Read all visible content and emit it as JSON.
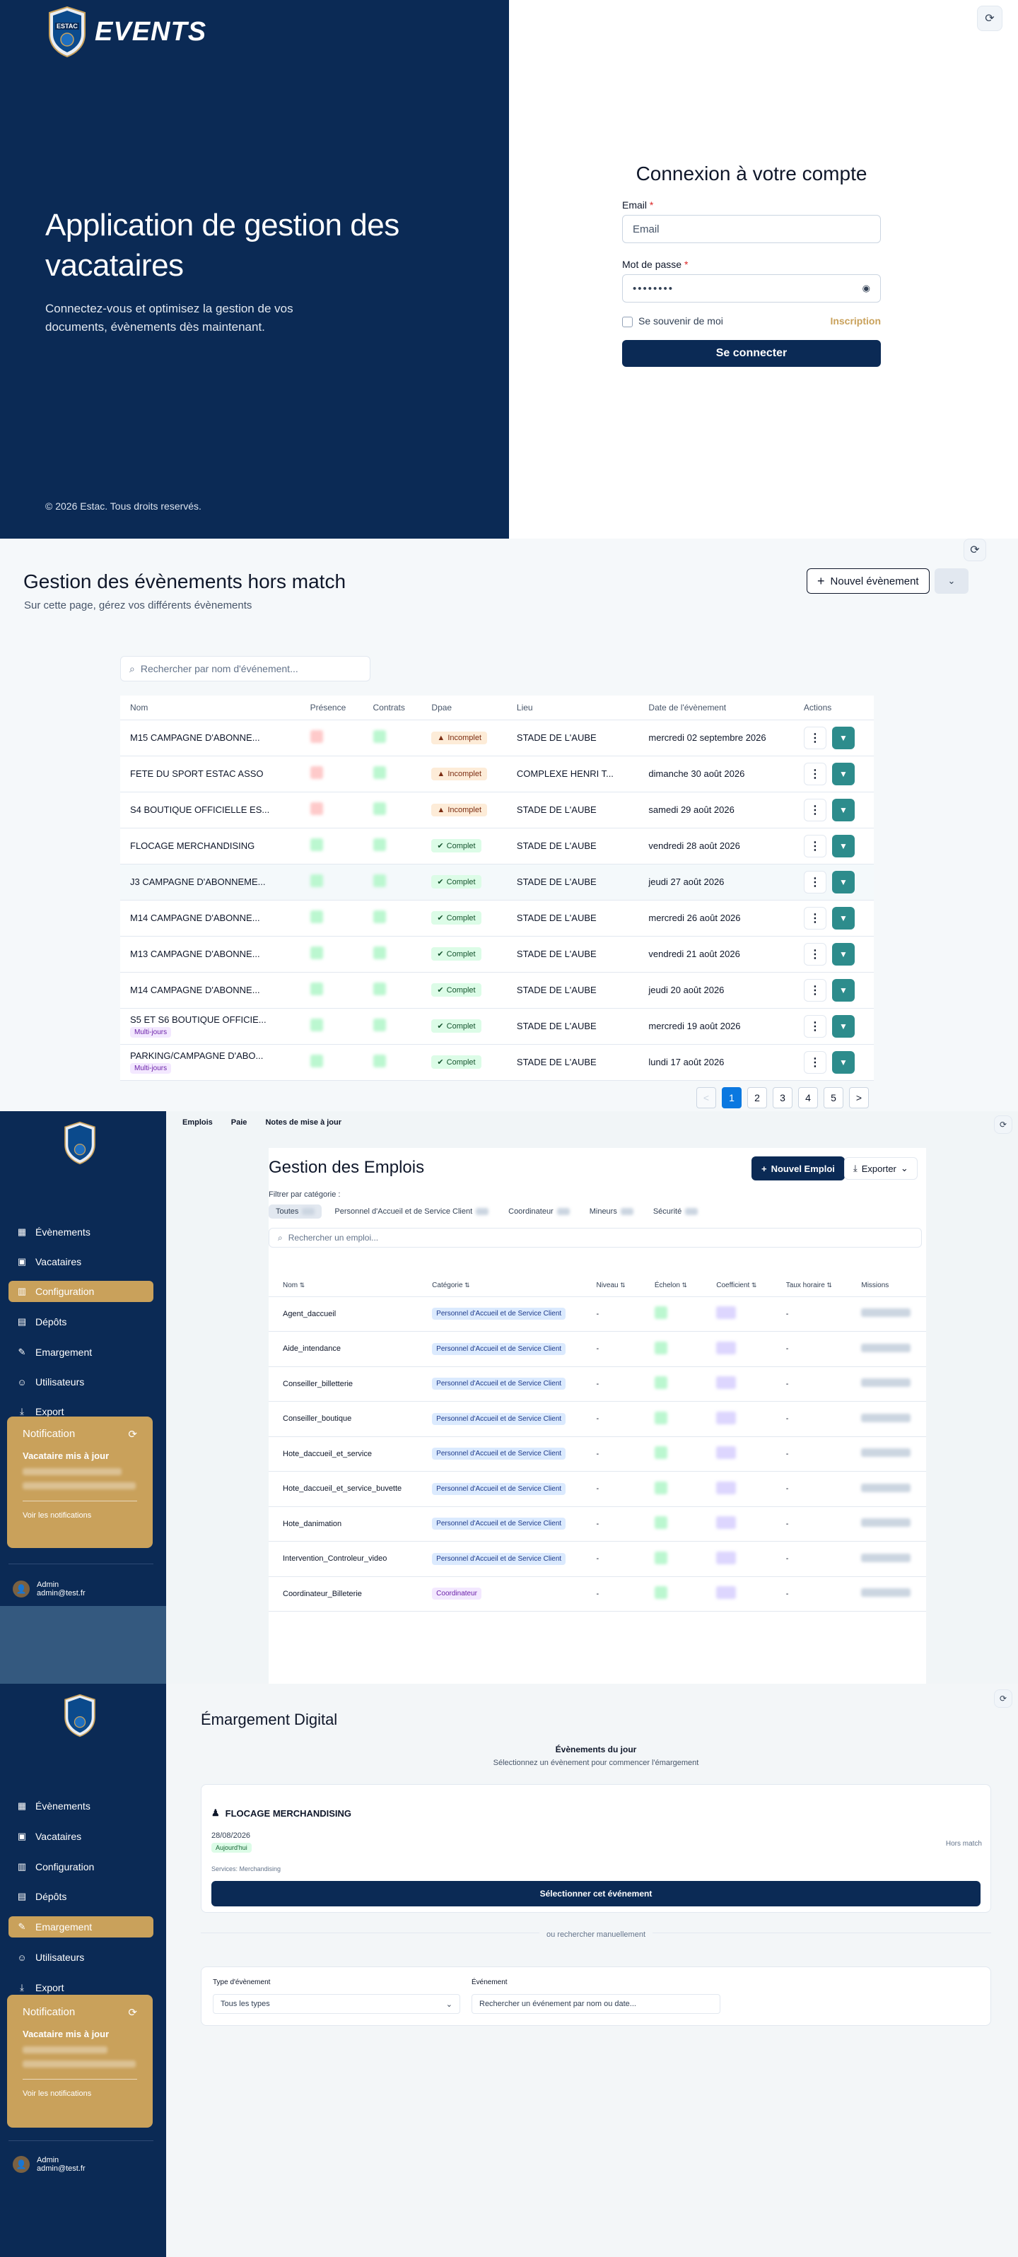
{
  "login": {
    "brand": "EVENTS",
    "logo_text": "ESTAC",
    "headline": "Application de gestion des vacataires",
    "lead": "Connectez-vous et optimisez la gestion de vos documents, évènements dès maintenant.",
    "copyright": "© 2026 Estac. Tous droits reservés.",
    "form_title": "Connexion à votre compte",
    "email_label": "Email",
    "email_placeholder": "Email",
    "password_label": "Mot de passe",
    "password_value": "••••••••",
    "remember_label": "Se souvenir de moi",
    "register_link": "Inscription",
    "submit": "Se connecter",
    "required_mark": "*"
  },
  "events": {
    "title": "Gestion des évènements hors match",
    "subtitle": "Sur cette page, gérez vos différents évènements",
    "new_button": "Nouvel évènement",
    "search_placeholder": "Rechercher par nom d'événement...",
    "columns": [
      "Nom",
      "Présence",
      "Contrats",
      "Dpae",
      "Lieu",
      "Date de l'évènement",
      "Actions"
    ],
    "rows": [
      {
        "name": "M15 CAMPAGNE D'ABONNE...",
        "dpae": "Incomplet",
        "lieu": "STADE DE L'AUBE",
        "date": "mercredi 02 septembre 2026",
        "multi": ""
      },
      {
        "name": "FETE DU SPORT ESTAC ASSO",
        "dpae": "Incomplet",
        "lieu": "COMPLEXE HENRI T...",
        "date": "dimanche 30 août 2026",
        "multi": ""
      },
      {
        "name": "S4 BOUTIQUE OFFICIELLE ES...",
        "dpae": "Incomplet",
        "lieu": "STADE DE L'AUBE",
        "date": "samedi 29 août 2026",
        "multi": ""
      },
      {
        "name": "FLOCAGE MERCHANDISING",
        "dpae": "Complet",
        "lieu": "STADE DE L'AUBE",
        "date": "vendredi 28 août 2026",
        "multi": ""
      },
      {
        "name": "J3 CAMPAGNE D'ABONNEME...",
        "dpae": "Complet",
        "lieu": "STADE DE L'AUBE",
        "date": "jeudi 27 août 2026",
        "multi": ""
      },
      {
        "name": "M14 CAMPAGNE D'ABONNE...",
        "dpae": "Complet",
        "lieu": "STADE DE L'AUBE",
        "date": "mercredi 26 août 2026",
        "multi": ""
      },
      {
        "name": "M13 CAMPAGNE D'ABONNE...",
        "dpae": "Complet",
        "lieu": "STADE DE L'AUBE",
        "date": "vendredi 21 août 2026",
        "multi": ""
      },
      {
        "name": "M14 CAMPAGNE D'ABONNE...",
        "dpae": "Complet",
        "lieu": "STADE DE L'AUBE",
        "date": "jeudi 20 août 2026",
        "multi": ""
      },
      {
        "name": "S5 ET S6 BOUTIQUE OFFICIE...",
        "dpae": "Complet",
        "lieu": "STADE DE L'AUBE",
        "date": "mercredi 19 août 2026",
        "multi": "Multi-jours"
      },
      {
        "name": "PARKING/CAMPAGNE D'ABO...",
        "dpae": "Complet",
        "lieu": "STADE DE L'AUBE",
        "date": "lundi 17 août 2026",
        "multi": "Multi-jours"
      }
    ],
    "pages": [
      "<",
      "1",
      "2",
      "3",
      "4",
      "5",
      ">"
    ]
  },
  "nav": {
    "items": [
      "Évènements",
      "Vacataires",
      "Configuration",
      "Dépôts",
      "Emargement",
      "Utilisateurs",
      "Export"
    ],
    "notif_title": "Notification",
    "notif_text": "Vacataire mis à jour",
    "notif_link": "Voir les notifications",
    "user_name": "Admin",
    "user_email": "admin@test.fr"
  },
  "jobs": {
    "tabs": [
      "Emplois",
      "Paie",
      "Notes de mise à jour"
    ],
    "title": "Gestion des Emplois",
    "new_button": "Nouvel Emploi",
    "export_button": "Exporter",
    "filter_label": "Filtrer par catégorie :",
    "chips": [
      "Toutes",
      "Personnel d'Accueil et de Service Client",
      "Coordinateur",
      "Mineurs",
      "Sécurité"
    ],
    "search_placeholder": "Rechercher un emploi...",
    "columns": [
      "Nom",
      "Catégorie",
      "Niveau",
      "Échelon",
      "Coefficient",
      "Taux horaire",
      "Missions"
    ],
    "rows": [
      {
        "name": "Agent_daccueil",
        "cat": "Personnel d'Accueil et de Service Client",
        "niveau": "-",
        "taux": "-"
      },
      {
        "name": "Aide_intendance",
        "cat": "Personnel d'Accueil et de Service Client",
        "niveau": "-",
        "taux": "-"
      },
      {
        "name": "Conseiller_billetterie",
        "cat": "Personnel d'Accueil et de Service Client",
        "niveau": "-",
        "taux": "-"
      },
      {
        "name": "Conseiller_boutique",
        "cat": "Personnel d'Accueil et de Service Client",
        "niveau": "-",
        "taux": "-"
      },
      {
        "name": "Hote_daccueil_et_service",
        "cat": "Personnel d'Accueil et de Service Client",
        "niveau": "-",
        "taux": "-"
      },
      {
        "name": "Hote_daccueil_et_service_buvette",
        "cat": "Personnel d'Accueil et de Service Client",
        "niveau": "-",
        "taux": "-"
      },
      {
        "name": "Hote_danimation",
        "cat": "Personnel d'Accueil et de Service Client",
        "niveau": "-",
        "taux": "-"
      },
      {
        "name": "Intervention_Controleur_video",
        "cat": "Personnel d'Accueil et de Service Client",
        "niveau": "-",
        "taux": "-"
      },
      {
        "name": "Coordinateur_Billeterie",
        "cat": "Coordinateur",
        "niveau": "-",
        "taux": "-"
      }
    ]
  },
  "emarg": {
    "title": "Émargement Digital",
    "today_title": "Évènements du jour",
    "today_sub": "Sélectionnez un évènement pour commencer l'émargement",
    "event_name": "FLOCAGE MERCHANDISING",
    "event_date": "28/08/2026",
    "today_badge": "Aujourd'hui",
    "event_kind": "Hors match",
    "services": "Services: Merchandising",
    "select_button": "Sélectionner cet événement",
    "or_text": "ou rechercher manuellement",
    "type_label": "Type d'évènement",
    "type_value": "Tous les types",
    "event_label": "Événement",
    "event_placeholder": "Rechercher un événement par nom ou date..."
  }
}
